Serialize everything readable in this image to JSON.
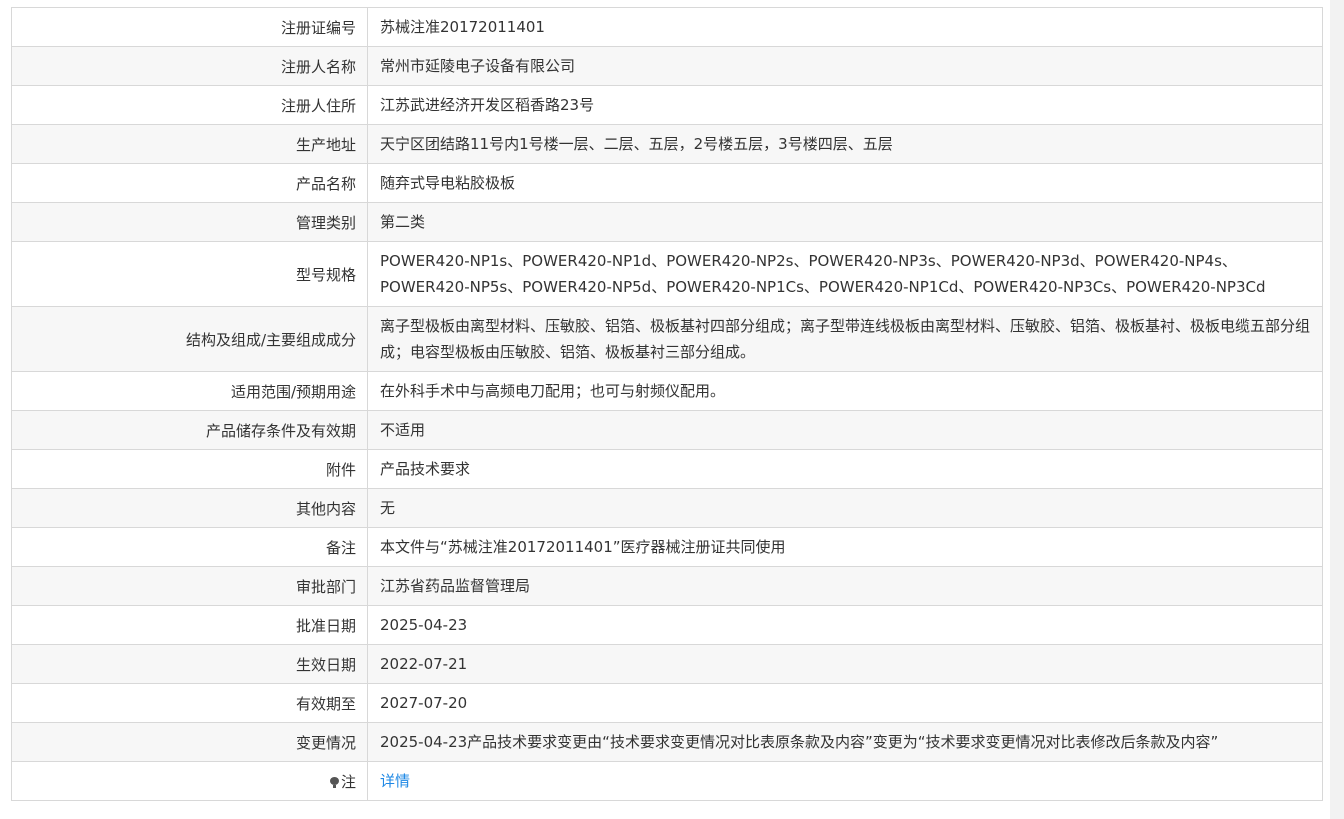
{
  "rows": [
    {
      "label": "注册证编号",
      "value": "苏械注准20172011401"
    },
    {
      "label": "注册人名称",
      "value": "常州市延陵电子设备有限公司"
    },
    {
      "label": "注册人住所",
      "value": "江苏武进经济开发区稻香路23号"
    },
    {
      "label": "生产地址",
      "value": "天宁区团结路11号内1号楼一层、二层、五层，2号楼五层，3号楼四层、五层"
    },
    {
      "label": "产品名称",
      "value": "随弃式导电粘胶极板"
    },
    {
      "label": "管理类别",
      "value": "第二类"
    },
    {
      "label": "型号规格",
      "value": "POWER420-NP1s、POWER420-NP1d、POWER420-NP2s、POWER420-NP3s、POWER420-NP3d、POWER420-NP4s、POWER420-NP5s、POWER420-NP5d、POWER420-NP1Cs、POWER420-NP1Cd、POWER420-NP3Cs、POWER420-NP3Cd"
    },
    {
      "label": "结构及组成/主要组成成分",
      "value": "离子型极板由离型材料、压敏胶、铝箔、极板基衬四部分组成；离子型带连线极板由离型材料、压敏胶、铝箔、极板基衬、极板电缆五部分组成；电容型极板由压敏胶、铝箔、极板基衬三部分组成。"
    },
    {
      "label": "适用范围/预期用途",
      "value": "在外科手术中与高频电刀配用；也可与射频仪配用。"
    },
    {
      "label": "产品储存条件及有效期",
      "value": "不适用"
    },
    {
      "label": "附件",
      "value": "产品技术要求"
    },
    {
      "label": "其他内容",
      "value": "无"
    },
    {
      "label": "备注",
      "value": "本文件与“苏械注准20172011401”医疗器械注册证共同使用"
    },
    {
      "label": "审批部门",
      "value": "江苏省药品监督管理局"
    },
    {
      "label": "批准日期",
      "value": "2025-04-23"
    },
    {
      "label": "生效日期",
      "value": "2022-07-21"
    },
    {
      "label": "有效期至",
      "value": "2027-07-20"
    },
    {
      "label": "变更情况",
      "value": "2025-04-23产品技术要求变更由“技术要求变更情况对比表原条款及内容”变更为“技术要求变更情况对比表修改后条款及内容”"
    }
  ],
  "note_row": {
    "label": "注",
    "link_text": "详情",
    "icon": "lightbulb-icon"
  },
  "colors": {
    "link": "#1e88e5",
    "border": "#d8d8d8",
    "stripe": "#f7f7f7"
  }
}
